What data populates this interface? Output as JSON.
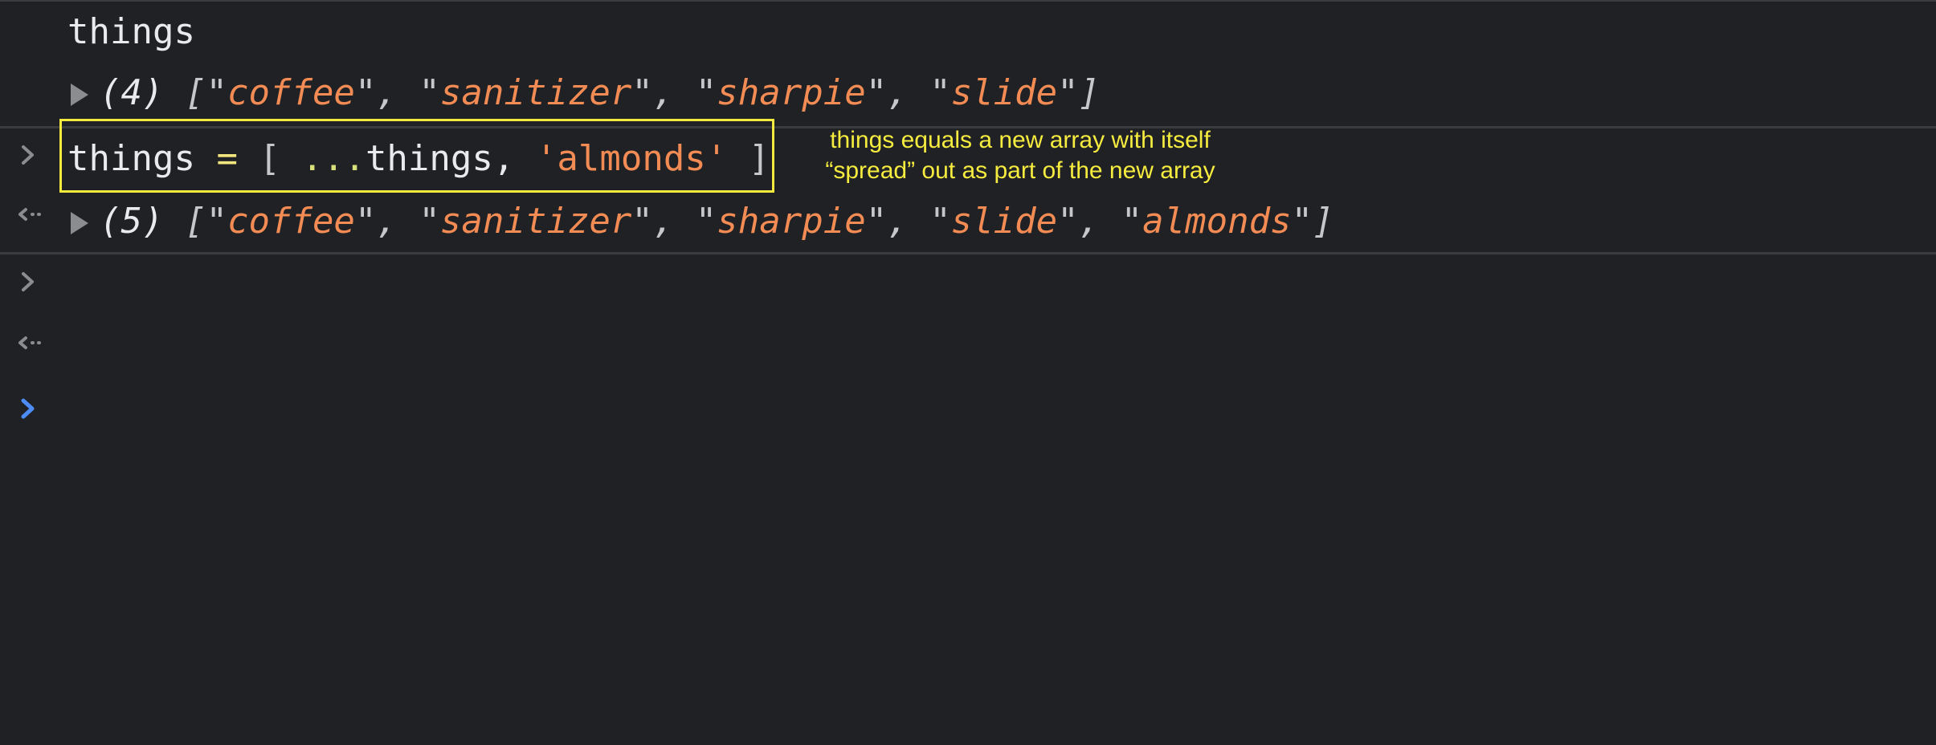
{
  "console": {
    "entries": [
      {
        "type": "input",
        "code": "things"
      },
      {
        "type": "output",
        "count": "(4)",
        "items": [
          "coffee",
          "sanitizer",
          "sharpie",
          "slide"
        ]
      },
      {
        "type": "input",
        "code_var": "things",
        "code_op": "=",
        "code_open": "[",
        "code_spread": "...",
        "code_spread_var": "things,",
        "code_str": "'almonds'",
        "code_close": "]"
      },
      {
        "type": "output",
        "count": "(5)",
        "items": [
          "coffee",
          "sanitizer",
          "sharpie",
          "slide",
          "almonds"
        ]
      }
    ],
    "prompt_icon": "chevron-right-icon",
    "result_icon": "return-arrow-icon"
  },
  "annotation": {
    "line1": "things equals a new array with itself",
    "line2": "“spread” out as part of the new array"
  },
  "colors": {
    "background": "#202124",
    "string": "#f28b54",
    "highlight": "#f3ea3d",
    "prompt_active": "#4d8bf5"
  }
}
